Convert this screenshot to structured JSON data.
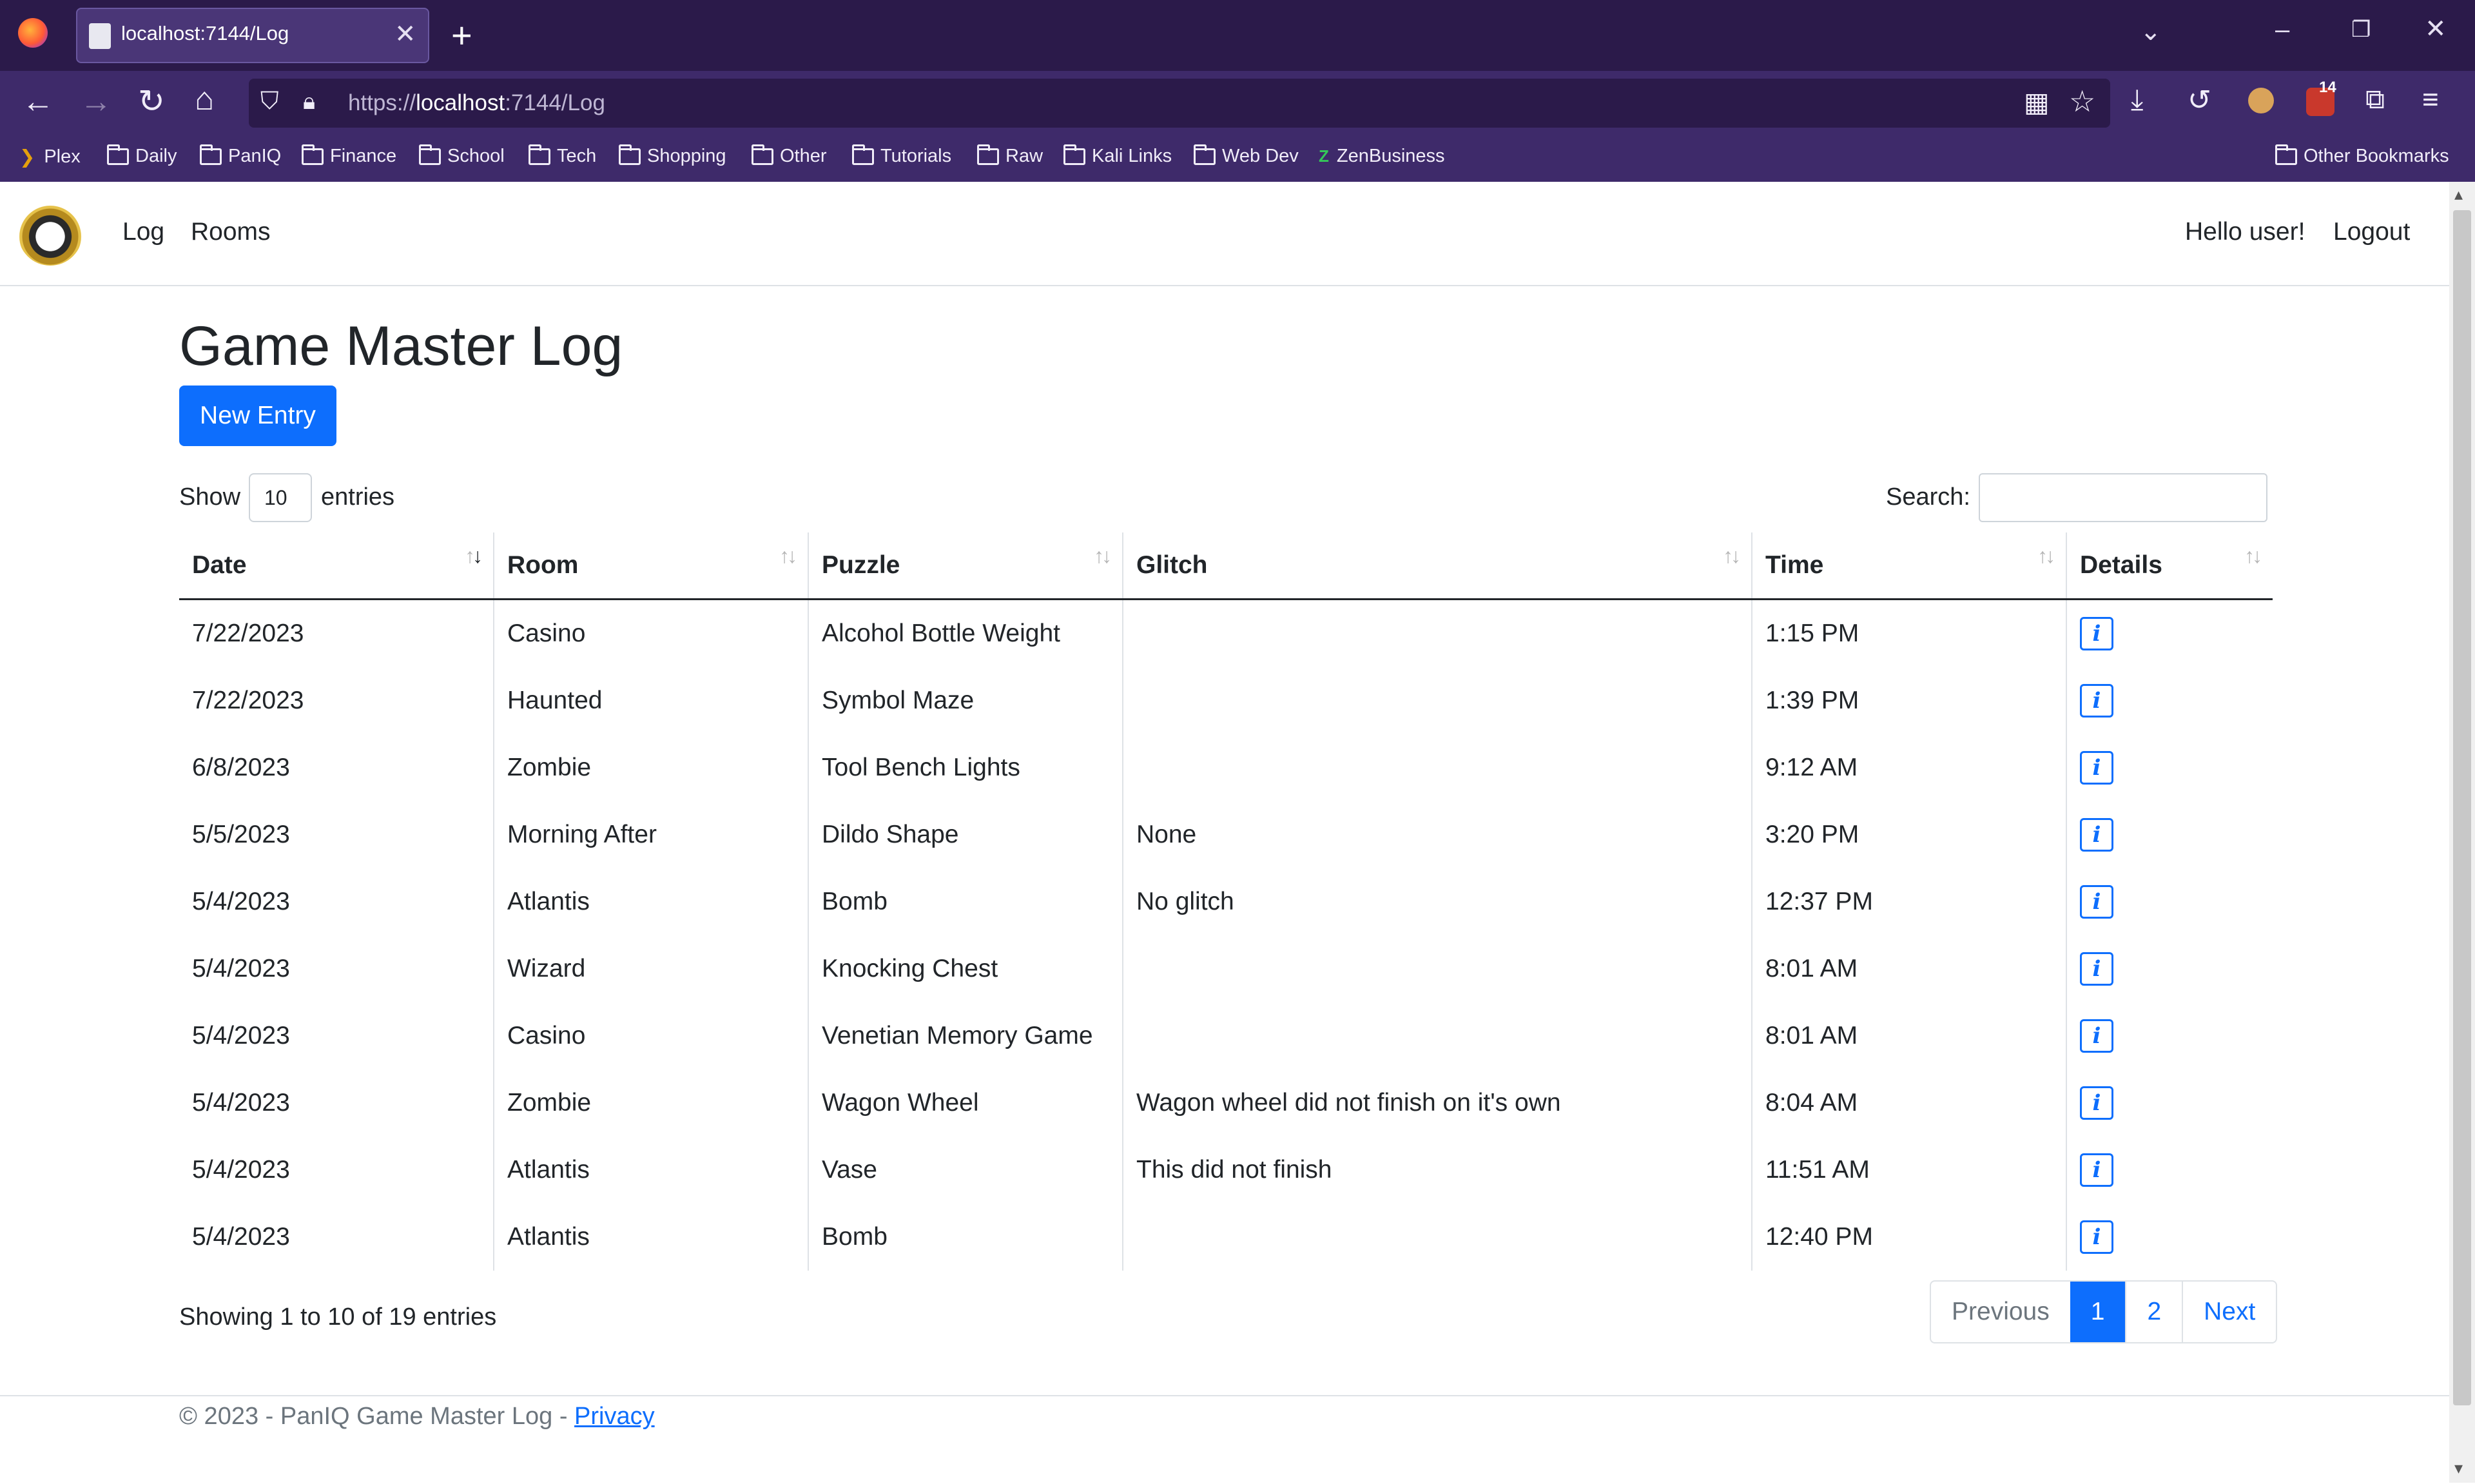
{
  "browser": {
    "tab_title": "localhost:7144/Log",
    "url_proto": "https://",
    "url_host": "localhost",
    "url_path": ":7144/Log",
    "extension_badge": "14",
    "bookmarks": [
      "Plex",
      "Daily",
      "PanIQ",
      "Finance",
      "School",
      "Tech",
      "Shopping",
      "Other",
      "Tutorials",
      "Raw",
      "Kali Links",
      "Web Dev",
      "ZenBusiness"
    ],
    "other_bookmarks": "Other Bookmarks"
  },
  "nav": {
    "links": [
      "Log",
      "Rooms"
    ],
    "greeting": "Hello user!",
    "logout": "Logout"
  },
  "main": {
    "title": "Game Master Log",
    "new_entry_label": "New Entry",
    "show_label": "Show",
    "page_length": "10",
    "entries_label": "entries",
    "search_label": "Search:",
    "columns": [
      "Date",
      "Room",
      "Puzzle",
      "Glitch",
      "Time",
      "Details"
    ],
    "rows": [
      [
        "7/22/2023",
        "Casino",
        "Alcohol Bottle Weight",
        "",
        "1:15 PM"
      ],
      [
        "7/22/2023",
        "Haunted",
        "Symbol Maze",
        "",
        "1:39 PM"
      ],
      [
        "6/8/2023",
        "Zombie",
        "Tool Bench Lights",
        "",
        "9:12 AM"
      ],
      [
        "5/5/2023",
        "Morning After",
        "Dildo Shape",
        "None",
        "3:20 PM"
      ],
      [
        "5/4/2023",
        "Atlantis",
        "Bomb",
        "No glitch",
        "12:37 PM"
      ],
      [
        "5/4/2023",
        "Wizard",
        "Knocking Chest",
        "",
        "8:01 AM"
      ],
      [
        "5/4/2023",
        "Casino",
        "Venetian Memory Game",
        "",
        "8:01 AM"
      ],
      [
        "5/4/2023",
        "Zombie",
        "Wagon Wheel",
        "Wagon wheel did not finish on it's own",
        "8:04 AM"
      ],
      [
        "5/4/2023",
        "Atlantis",
        "Vase",
        "This did not finish",
        "11:51 AM"
      ],
      [
        "5/4/2023",
        "Atlantis",
        "Bomb",
        "",
        "12:40 PM"
      ]
    ],
    "info_glyph": "i",
    "summary": "Showing 1 to 10 of 19 entries",
    "pagination": {
      "previous": "Previous",
      "pages": [
        "1",
        "2"
      ],
      "active": "1",
      "next": "Next"
    }
  },
  "footer": {
    "text": "© 2023 - PanIQ Game Master Log - ",
    "privacy": "Privacy"
  },
  "colors": {
    "primary": "#0d6efd",
    "chrome_dark": "#2b1a4a",
    "chrome": "#3e2a6a"
  }
}
